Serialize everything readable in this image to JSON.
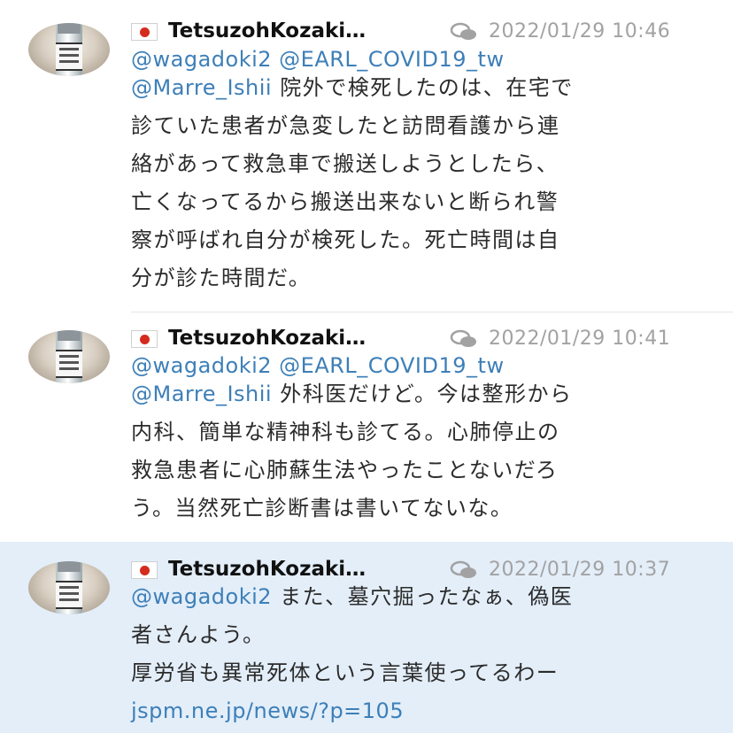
{
  "tweets": [
    {
      "author": "TetsuzohKozaki…",
      "time": "2022/01/29 10:46",
      "lines": [
        {
          "mentions": "@wagadoki2 @EARL_COVID19_tw",
          "text": ""
        },
        {
          "mentions": "@Marre_Ishii",
          "text": "院外で検死したのは、在宅で"
        },
        {
          "mentions": "",
          "text": "診ていた患者が急変したと訪問看護から連"
        },
        {
          "mentions": "",
          "text": "絡があって救急車で搬送しようとしたら、"
        },
        {
          "mentions": "",
          "text": "亡くなってるから搬送出来ないと断られ警"
        },
        {
          "mentions": "",
          "text": "察が呼ばれ自分が検死した。死亡時間は自"
        },
        {
          "mentions": "",
          "text": "分が診た時間だ。"
        }
      ]
    },
    {
      "author": "TetsuzohKozaki…",
      "time": "2022/01/29 10:41",
      "lines": [
        {
          "mentions": "@wagadoki2 @EARL_COVID19_tw",
          "text": ""
        },
        {
          "mentions": "@Marre_Ishii",
          "text": "外科医だけど。今は整形から"
        },
        {
          "mentions": "",
          "text": "内科、簡単な精神科も診てる。心肺停止の"
        },
        {
          "mentions": "",
          "text": "救急患者に心肺蘇生法やったことないだろ"
        },
        {
          "mentions": "",
          "text": "う。当然死亡診断書は書いてないな。"
        }
      ]
    },
    {
      "author": "TetsuzohKozaki…",
      "time": "2022/01/29 10:37",
      "lines": [
        {
          "mentions": "@wagadoki2",
          "text": "また、墓穴掘ったなぁ、偽医"
        },
        {
          "mentions": "",
          "text": "者さんよう。"
        },
        {
          "mentions": "",
          "text": "厚労省も異常死体という言葉使ってるわー"
        }
      ],
      "link": "jspm.ne.jp/news/?p=105"
    }
  ],
  "icons": {
    "flag": "japan-flag-icon",
    "reply": "conversation-icon"
  },
  "colors": {
    "mention": "#3d7fb8",
    "time": "#a2a2a2",
    "highlight_bg": "#e3eef9"
  }
}
